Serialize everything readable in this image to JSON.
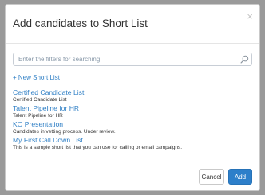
{
  "dialog": {
    "title": "Add candidates to Short List",
    "close_glyph": "×"
  },
  "search": {
    "placeholder": "Enter the filters for searching",
    "icon": "search-icon"
  },
  "new_short_list_label": "+ New Short List",
  "short_lists": [
    {
      "name": "Certified Candidate List",
      "description": "Certified Candidate List"
    },
    {
      "name": "Talent Pipeline for HR",
      "description": "Talent Pipeline for HR"
    },
    {
      "name": "KO Presentation",
      "description": "Candidates in vetting process. Under review."
    },
    {
      "name": "My First Call Down List",
      "description": "This is a sample short list that you can use for calling or email campaigns."
    }
  ],
  "footer": {
    "cancel_label": "Cancel",
    "add_label": "Add"
  },
  "colors": {
    "link": "#2f7fc5",
    "primary_button": "#2d7fca",
    "backdrop": "#9a9a9a"
  }
}
